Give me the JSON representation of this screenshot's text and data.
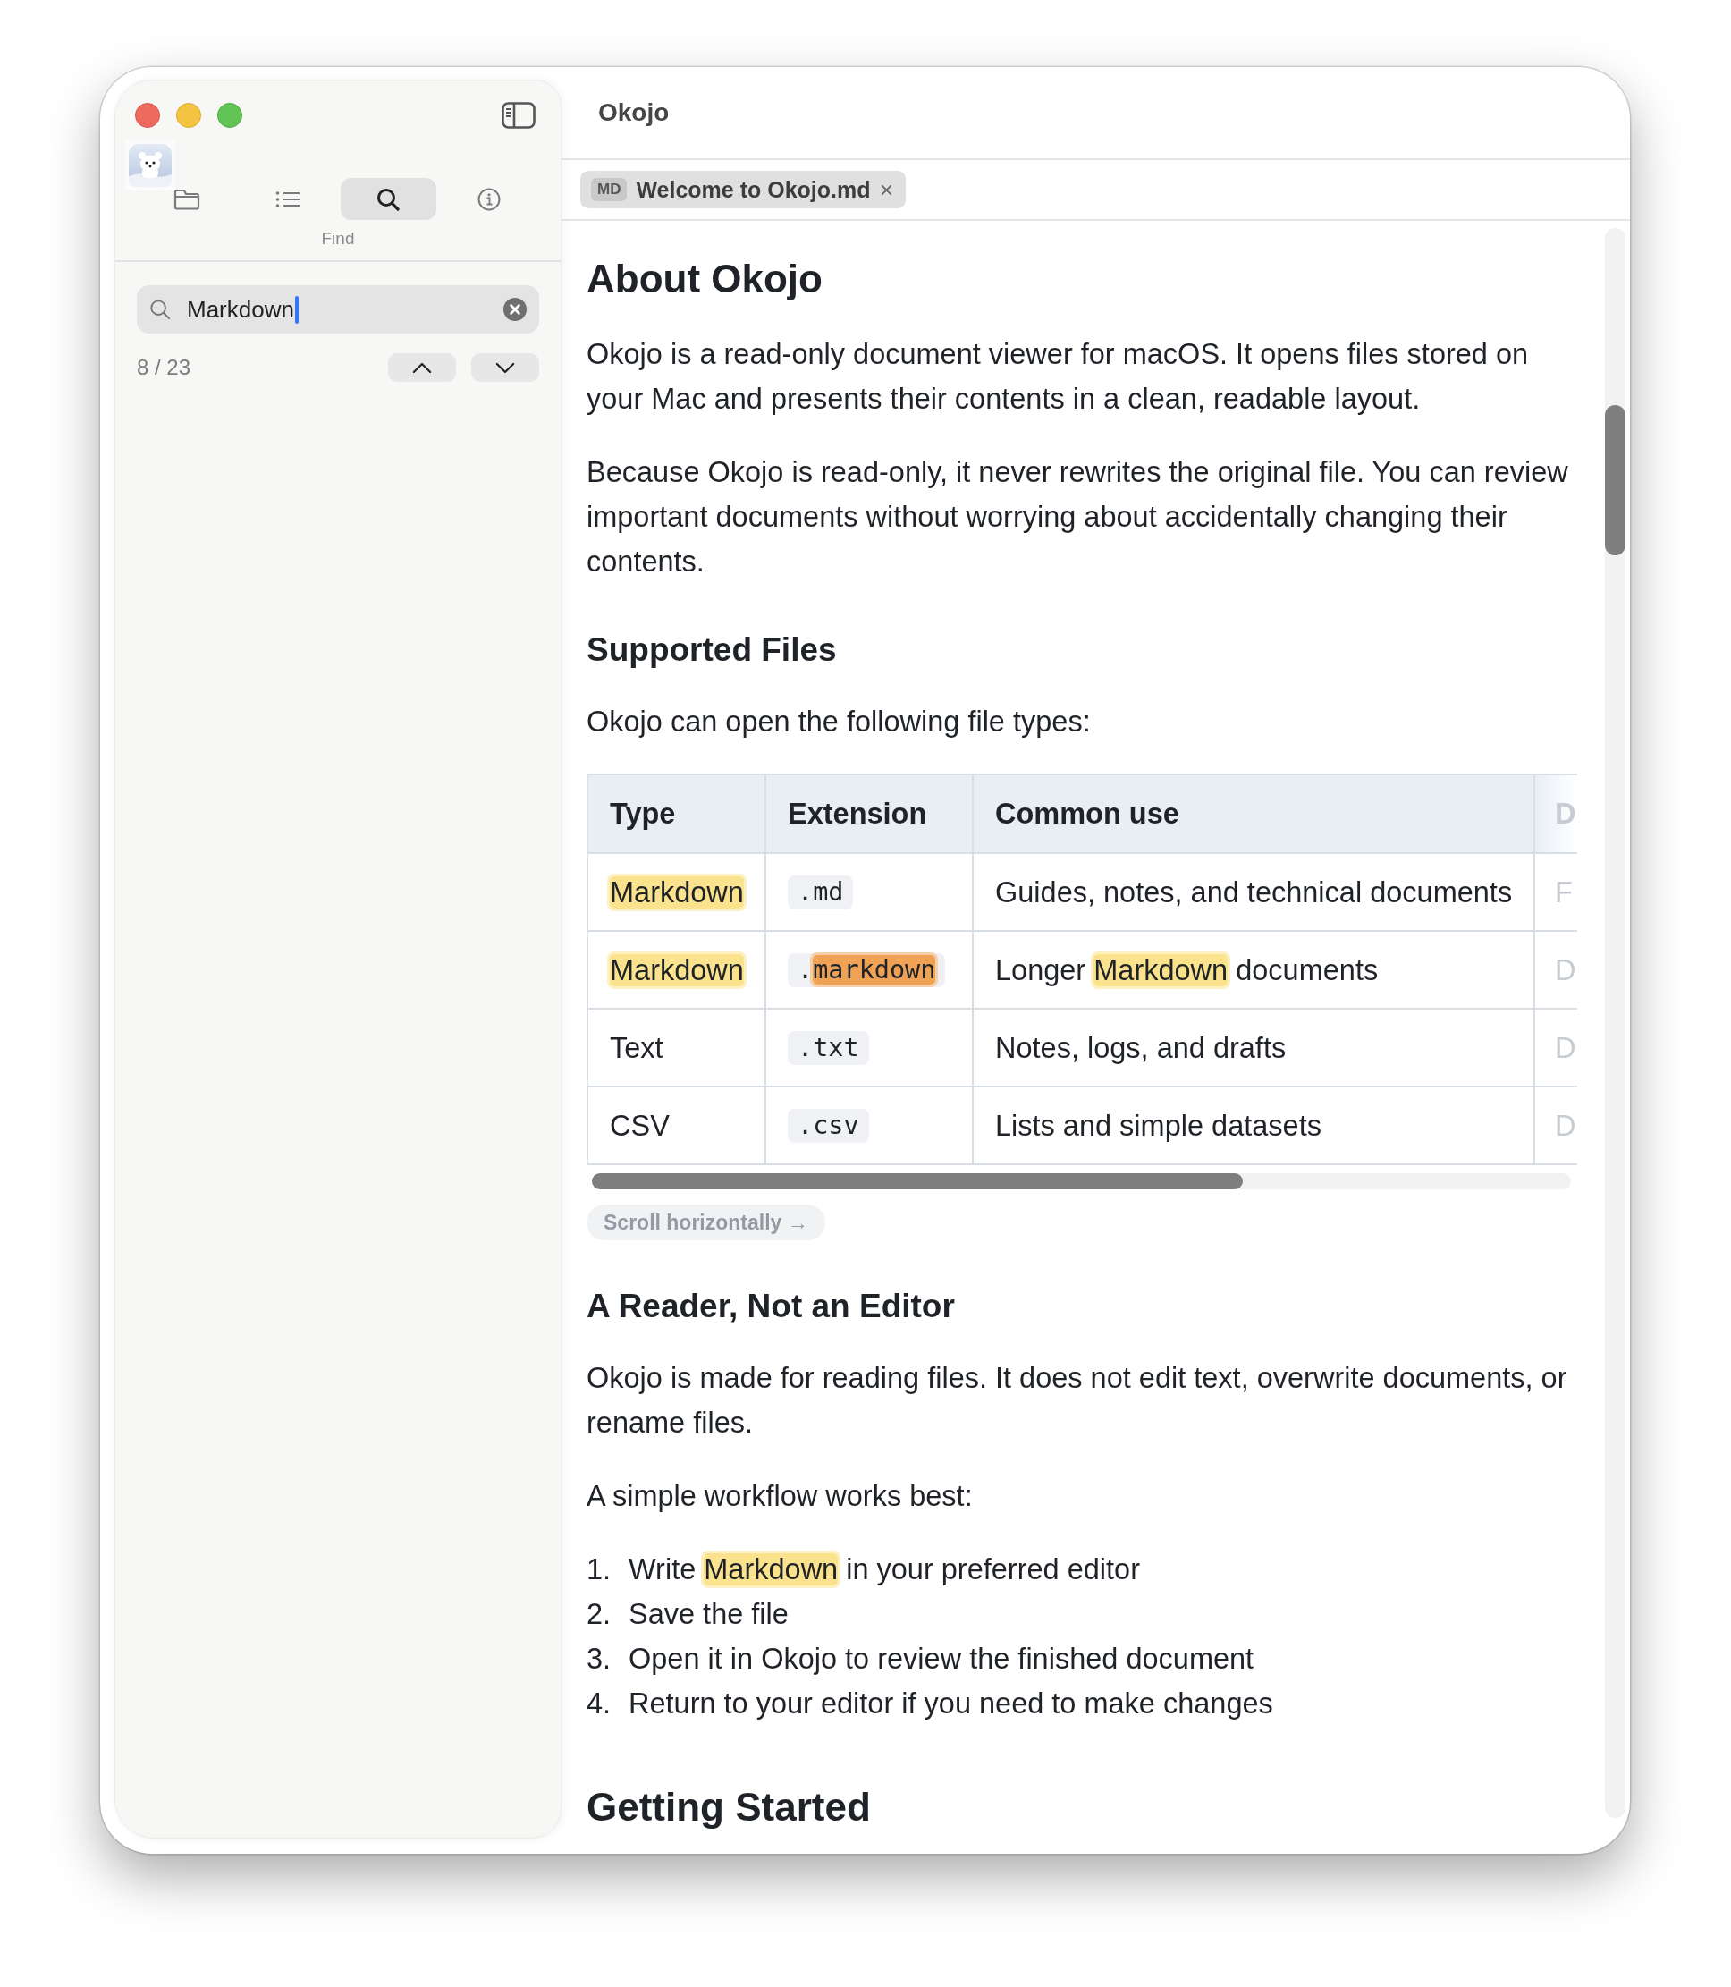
{
  "window": {
    "title": "Okojo"
  },
  "sidebar": {
    "tabs": [
      {
        "kind": "files",
        "selected": false
      },
      {
        "kind": "outline",
        "selected": false
      },
      {
        "kind": "find",
        "selected": true
      },
      {
        "kind": "info",
        "selected": false
      }
    ],
    "section_title": "Find",
    "search": {
      "value": "Markdown"
    },
    "match_count": "8 / 23"
  },
  "tabs": [
    {
      "badge": "MD",
      "label": "Welcome to Okojo.md",
      "selected": true
    }
  ],
  "document": [
    {
      "kind": "heading1",
      "text": "About Okojo"
    },
    {
      "kind": "paragraph",
      "text": "Okojo is a read-only document viewer for macOS. It opens files stored on your Mac and presents their contents in a clean, readable layout."
    },
    {
      "kind": "paragraph",
      "text": "Because Okojo is read-only, it never rewrites the original file. You can review important documents without worrying about accidentally changing their contents."
    },
    {
      "kind": "heading2",
      "text": "Supported Files"
    },
    {
      "kind": "paragraph",
      "text": "Okojo can open the following file types:"
    },
    {
      "kind": "table",
      "columns": [
        "Type",
        "Extension",
        "Common use",
        "D"
      ],
      "rows": [
        {
          "cells": [
            {
              "kind": "text",
              "runs": [
                {
                  "text": "Markdown",
                  "match": true,
                  "current": false
                }
              ]
            },
            {
              "kind": "code",
              "runs": [
                {
                  "text": ".md",
                  "match": false,
                  "current": false
                }
              ]
            },
            {
              "kind": "text",
              "runs": [
                {
                  "text": "Guides, notes, and technical documents",
                  "match": false,
                  "current": false
                }
              ]
            },
            {
              "kind": "text",
              "runs": [
                {
                  "text": "F",
                  "match": false,
                  "current": false
                }
              ]
            }
          ]
        },
        {
          "cells": [
            {
              "kind": "text",
              "runs": [
                {
                  "text": "Markdown",
                  "match": true,
                  "current": false
                }
              ]
            },
            {
              "kind": "code",
              "runs": [
                {
                  "text": ".",
                  "match": false,
                  "current": false
                },
                {
                  "text": "markdown",
                  "match": true,
                  "current": true
                }
              ]
            },
            {
              "kind": "text",
              "runs": [
                {
                  "text": "Longer ",
                  "match": false,
                  "current": false
                },
                {
                  "text": "Markdown",
                  "match": true,
                  "current": false
                },
                {
                  "text": " documents",
                  "match": false,
                  "current": false
                }
              ]
            },
            {
              "kind": "text",
              "runs": [
                {
                  "text": "D",
                  "match": false,
                  "current": false
                }
              ]
            }
          ]
        },
        {
          "cells": [
            {
              "kind": "text",
              "runs": [
                {
                  "text": "Text",
                  "match": false,
                  "current": false
                }
              ]
            },
            {
              "kind": "code",
              "runs": [
                {
                  "text": ".txt",
                  "match": false,
                  "current": false
                }
              ]
            },
            {
              "kind": "text",
              "runs": [
                {
                  "text": "Notes, logs, and drafts",
                  "match": false,
                  "current": false
                }
              ]
            },
            {
              "kind": "text",
              "runs": [
                {
                  "text": "D",
                  "match": false,
                  "current": false
                }
              ]
            }
          ]
        },
        {
          "cells": [
            {
              "kind": "text",
              "runs": [
                {
                  "text": "CSV",
                  "match": false,
                  "current": false
                }
              ]
            },
            {
              "kind": "code",
              "runs": [
                {
                  "text": ".csv",
                  "match": false,
                  "current": false
                }
              ]
            },
            {
              "kind": "text",
              "runs": [
                {
                  "text": "Lists and simple datasets",
                  "match": false,
                  "current": false
                }
              ]
            },
            {
              "kind": "text",
              "runs": [
                {
                  "text": "D",
                  "match": false,
                  "current": false
                }
              ]
            }
          ]
        }
      ],
      "scroll_hint": "Scroll horizontally →"
    },
    {
      "kind": "heading2",
      "text": "A Reader, Not an Editor"
    },
    {
      "kind": "paragraph",
      "text": "Okojo is made for reading files. It does not edit text, overwrite documents, or rename files."
    },
    {
      "kind": "paragraph",
      "text": "A simple workflow works best:"
    },
    {
      "kind": "ordered_list",
      "items": [
        {
          "number": "1.",
          "runs": [
            {
              "text": "Write ",
              "match": false,
              "current": false
            },
            {
              "text": "Markdown",
              "match": true,
              "current": false
            },
            {
              "text": " in your preferred editor",
              "match": false,
              "current": false
            }
          ]
        },
        {
          "number": "2.",
          "runs": [
            {
              "text": "Save the file",
              "match": false,
              "current": false
            }
          ]
        },
        {
          "number": "3.",
          "runs": [
            {
              "text": "Open it in Okojo to review the finished document",
              "match": false,
              "current": false
            }
          ]
        },
        {
          "number": "4.",
          "runs": [
            {
              "text": "Return to your editor if you need to make changes",
              "match": false,
              "current": false
            }
          ]
        }
      ]
    },
    {
      "kind": "heading1",
      "text": "Getting Started"
    }
  ]
}
